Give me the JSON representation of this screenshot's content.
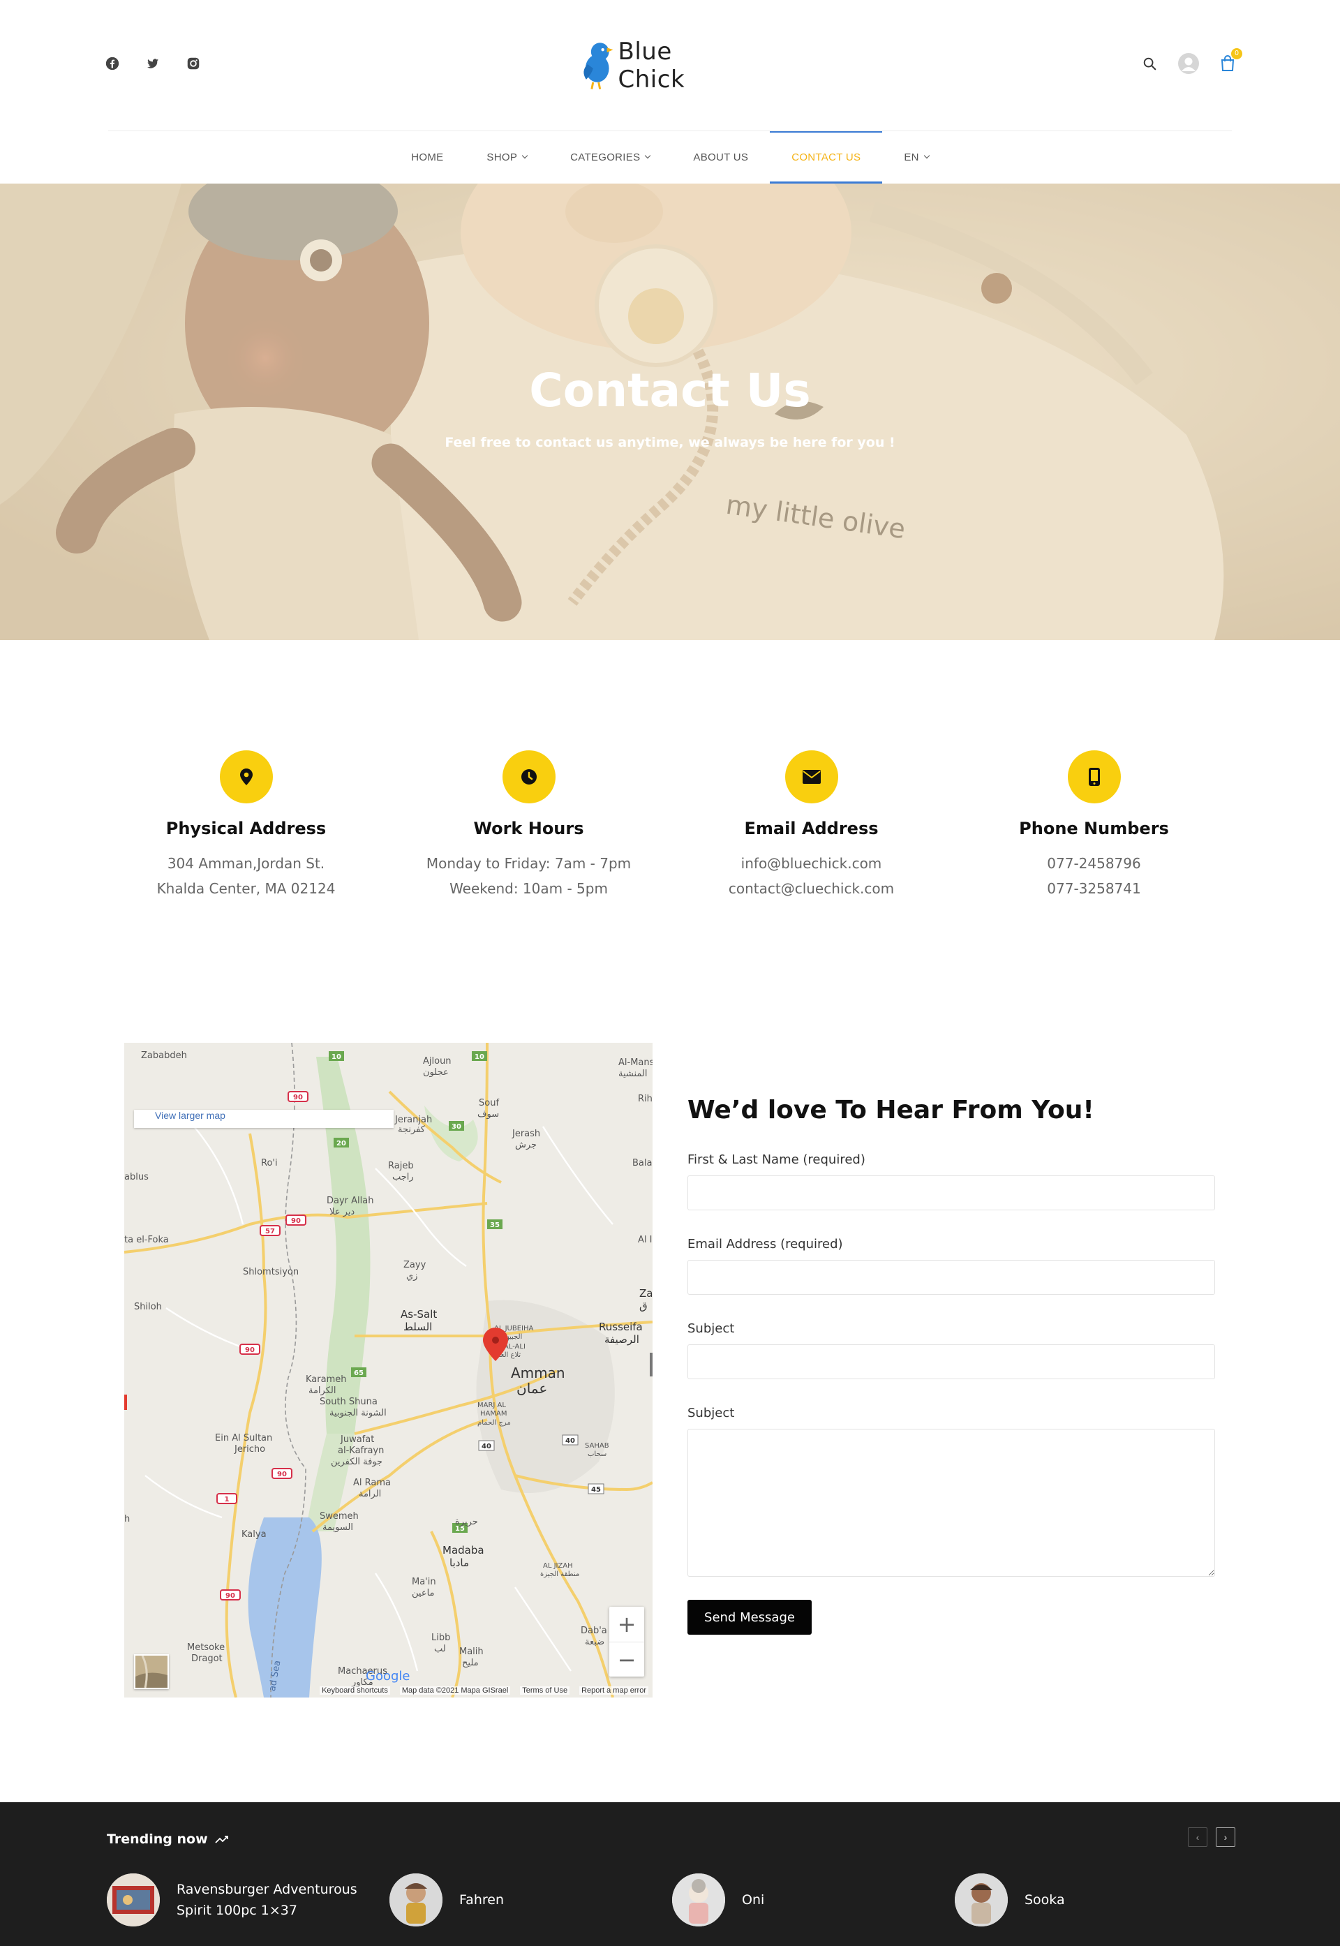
{
  "brand": {
    "name": "Blue Chick",
    "accent": "#f5b316",
    "yellow": "#f9cf0f",
    "blue": "#2a86d9"
  },
  "header": {
    "social": [
      "facebook-icon",
      "twitter-icon",
      "instagram-icon"
    ],
    "actions": [
      "search-icon",
      "user-avatar-icon",
      "cart-icon"
    ],
    "cart_count": "0"
  },
  "nav": {
    "home": "HOME",
    "shop": "SHOP",
    "categories": "CATEGORIES",
    "about": "ABOUT US",
    "contact": "CONTACT US",
    "lang": "EN"
  },
  "hero": {
    "title": "Contact Us",
    "subtitle": "Feel free to contact us anytime, we always be here for you !",
    "shirt_text": "my little olive"
  },
  "info": [
    {
      "icon": "map-marker-icon",
      "title": "Physical Address",
      "lines": [
        "304 Amman,Jordan St.",
        "Khalda Center, MA 02124"
      ]
    },
    {
      "icon": "clock-icon",
      "title": "Work Hours",
      "lines": [
        "Monday to Friday: 7am - 7pm",
        "Weekend: 10am - 5pm"
      ]
    },
    {
      "icon": "envelope-icon",
      "title": "Email Address",
      "lines": [
        "info@bluechick.com",
        "contact@cluechick.com"
      ]
    },
    {
      "icon": "mobile-phone-icon",
      "title": "Phone Numbers",
      "lines": [
        "077-2458796",
        "077-3258741"
      ]
    }
  ],
  "map": {
    "link": "View larger map",
    "places": {
      "zababdeh": "Zababdeh",
      "ajloun": "Ajloun",
      "ajloun_ar": "عجلون",
      "souf": "Souf",
      "souf_ar": "سوف",
      "jerash": "Jerash",
      "jerash_ar": "جرش",
      "jeranjah": "Jeranjah",
      "jeranjah_ar": "كفرنجة",
      "ro_i": "Ro'i",
      "rajeb": "Rajeb",
      "rajeb_ar": "راجب",
      "nablus": "ablus",
      "dayr_allah": "Dayr Allah",
      "dayr_allah_ar": "دير علا",
      "al_foka": "ta el-Foka",
      "shlomtsiyon": "Shlomtsiyon",
      "zayy": "Zayy",
      "zayy_ar": "زي",
      "shiloh": "Shiloh",
      "as_salt": "As-Salt",
      "as_salt_ar": "السلط",
      "russeifa": "Russeifa",
      "russeifa_ar": "الرصيفة",
      "al_jubeiha": "AL JUBEIHA",
      "al_jubeiha_ar": "الجبيهة",
      "tla_al_ali": "TLA AL-ALI",
      "tla_al_ali_ar": "تلاع العلي",
      "amman": "Amman",
      "amman_ar": "عمان",
      "karameh": "Karameh",
      "karameh_ar": "الكرامة",
      "south_shuna": "South Shuna",
      "south_shuna_ar": "الشونة الجنوبية",
      "marj": "MARJ AL",
      "hamam": "HAMAM",
      "marj_ar": "مرج الحمام",
      "ein_sultan": "Ein Al Sultan",
      "jericho": "Jericho",
      "juwafat": "Juwafat",
      "kafrayn": "al-Kafrayn",
      "kafrayn_ar": "جوفة الكفرين",
      "sahab": "SAHAB",
      "sahab_ar": "سحاب",
      "al_rama": "Al Rama",
      "al_rama_ar": "الرامة",
      "swemeh": "Swemeh",
      "swemeh_ar": "السويمة",
      "kalya": "Kalya",
      "hureira": "حريرة",
      "madaba": "Madaba",
      "madaba_ar": "مادبا",
      "al_jizah": "AL JIZAH",
      "al_jizah_ar": "منطقة الجيزة",
      "main": "Ma'in",
      "main_ar": "ماعين",
      "metsoke": "Metsoke",
      "dragot": "Dragot",
      "libb": "Libb",
      "libb_ar": "لب",
      "malih": "Malih",
      "malih_ar": "مليح",
      "dab_a": "Dab'a",
      "dab_a_ar": "ضبعة",
      "machaerus": "Machaerus",
      "machaerus_ar": "مكاور",
      "al_mans": "Al-Mans",
      "al_mans_ar": "المنشية",
      "rih": "Rih",
      "bala": "Bala",
      "al_i": "Al I",
      "za": "Za",
      "za_ar": "ق",
      "dead_sea": "ad Sea",
      "edge_h": "h"
    },
    "roads": [
      "90",
      "57",
      "1",
      "35",
      "65",
      "40",
      "45",
      "15",
      "30",
      "20",
      "10"
    ],
    "zoom_in": "+",
    "zoom_out": "−",
    "google": "Google",
    "footer": [
      "Keyboard shortcuts",
      "Map data ©2021 Mapa GISrael",
      "Terms of Use",
      "Report a map error"
    ]
  },
  "form": {
    "title": "We’d love To Hear From You!",
    "name_label": "First & Last Name (required)",
    "email_label": "Email Address (required)",
    "subject_label": "Subject",
    "message_label": "Subject",
    "submit": "Send Message"
  },
  "trending": {
    "title": "Trending now",
    "prev": "‹",
    "next": "›",
    "items": [
      {
        "name": "Ravensburger Adventurous Spirit 100pc 1×37"
      },
      {
        "name": "Fahren"
      },
      {
        "name": "Oni"
      },
      {
        "name": "Sooka"
      }
    ]
  }
}
